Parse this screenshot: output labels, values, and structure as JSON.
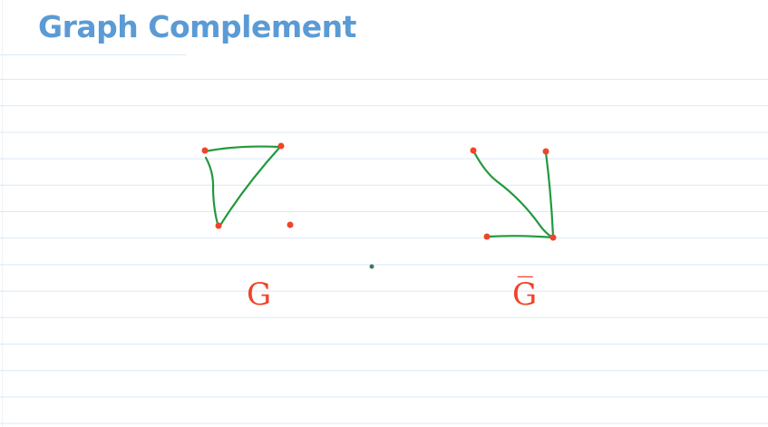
{
  "page": {
    "title": "Graph Complement"
  },
  "colors": {
    "title": "#5b9bd5",
    "rule_lines": "#dbe9f6",
    "vertex": "#f0442a",
    "edge": "#22993e"
  },
  "graphs": [
    {
      "label": "G",
      "vertices": 4,
      "edges": 3
    },
    {
      "label": "G̅",
      "vertices": 4,
      "edges": 3
    }
  ]
}
